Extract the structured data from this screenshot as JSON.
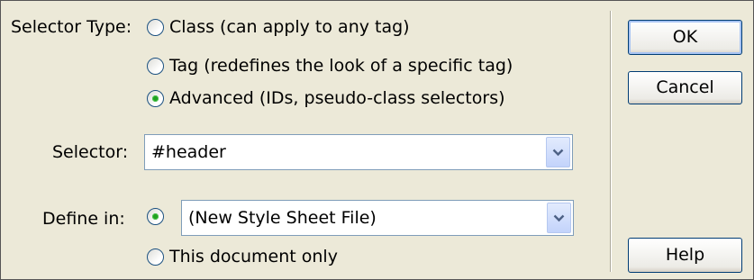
{
  "selector_type": {
    "label": "Selector Type:",
    "options": [
      {
        "label": "Class (can apply to any tag)",
        "checked": false
      },
      {
        "label": "Tag (redefines the look of a specific tag)",
        "checked": false
      },
      {
        "label": "Advanced (IDs, pseudo-class selectors)",
        "checked": true
      }
    ]
  },
  "selector": {
    "label": "Selector:",
    "value": "#header"
  },
  "define_in": {
    "label": "Define in:",
    "options": [
      {
        "label": "(New Style Sheet File)",
        "checked": true
      },
      {
        "label": "This document only",
        "checked": false
      }
    ]
  },
  "buttons": {
    "ok": "OK",
    "cancel": "Cancel",
    "help": "Help"
  },
  "colors": {
    "dialog_bg": "#ece9d8",
    "radio_dot": "#21a121",
    "button_border": "#003c74"
  }
}
